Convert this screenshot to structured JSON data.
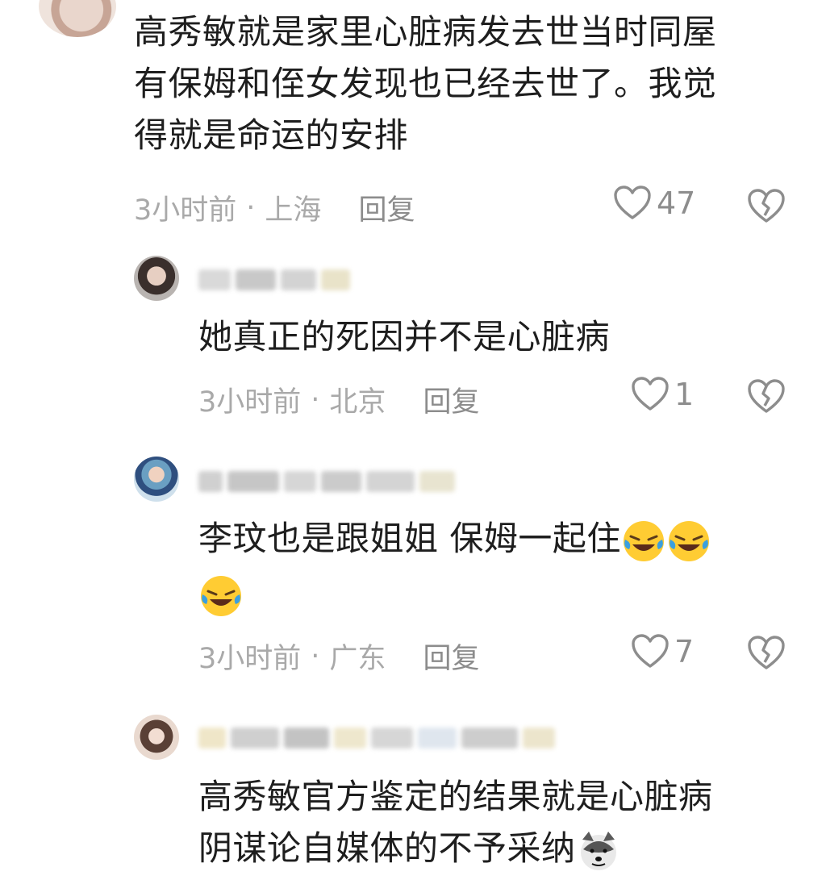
{
  "comments": [
    {
      "text": [
        "高秀敏就是家里心脏病发去世当时同屋",
        "有保姆和侄女发现也已经去世了。我觉",
        "得就是命运的安排"
      ],
      "time": "3小时前",
      "location": "上海",
      "reply": "回复",
      "likes": "47"
    },
    {
      "text": [
        "她真正的死因并不是心脏病"
      ],
      "time": "3小时前",
      "location": "北京",
      "reply": "回复",
      "likes": "1"
    },
    {
      "text": [
        "李玟也是跟姐姐 保姆一起住"
      ],
      "time": "3小时前",
      "location": "广东",
      "reply": "回复",
      "likes": "7"
    },
    {
      "text": [
        "高秀敏官方鉴定的结果就是心脏病",
        "阴谋论自媒体的不予采纳"
      ]
    }
  ],
  "separator": "·",
  "icons": {
    "like": "heart-outline-icon",
    "dislike": "broken-heart-icon",
    "laugh": "laughing-tears-emoji",
    "doge": "doge-emoji"
  },
  "colors": {
    "meta": "#a9a9a9",
    "icon": "#8d8d8d",
    "text": "#1e1e1e"
  }
}
